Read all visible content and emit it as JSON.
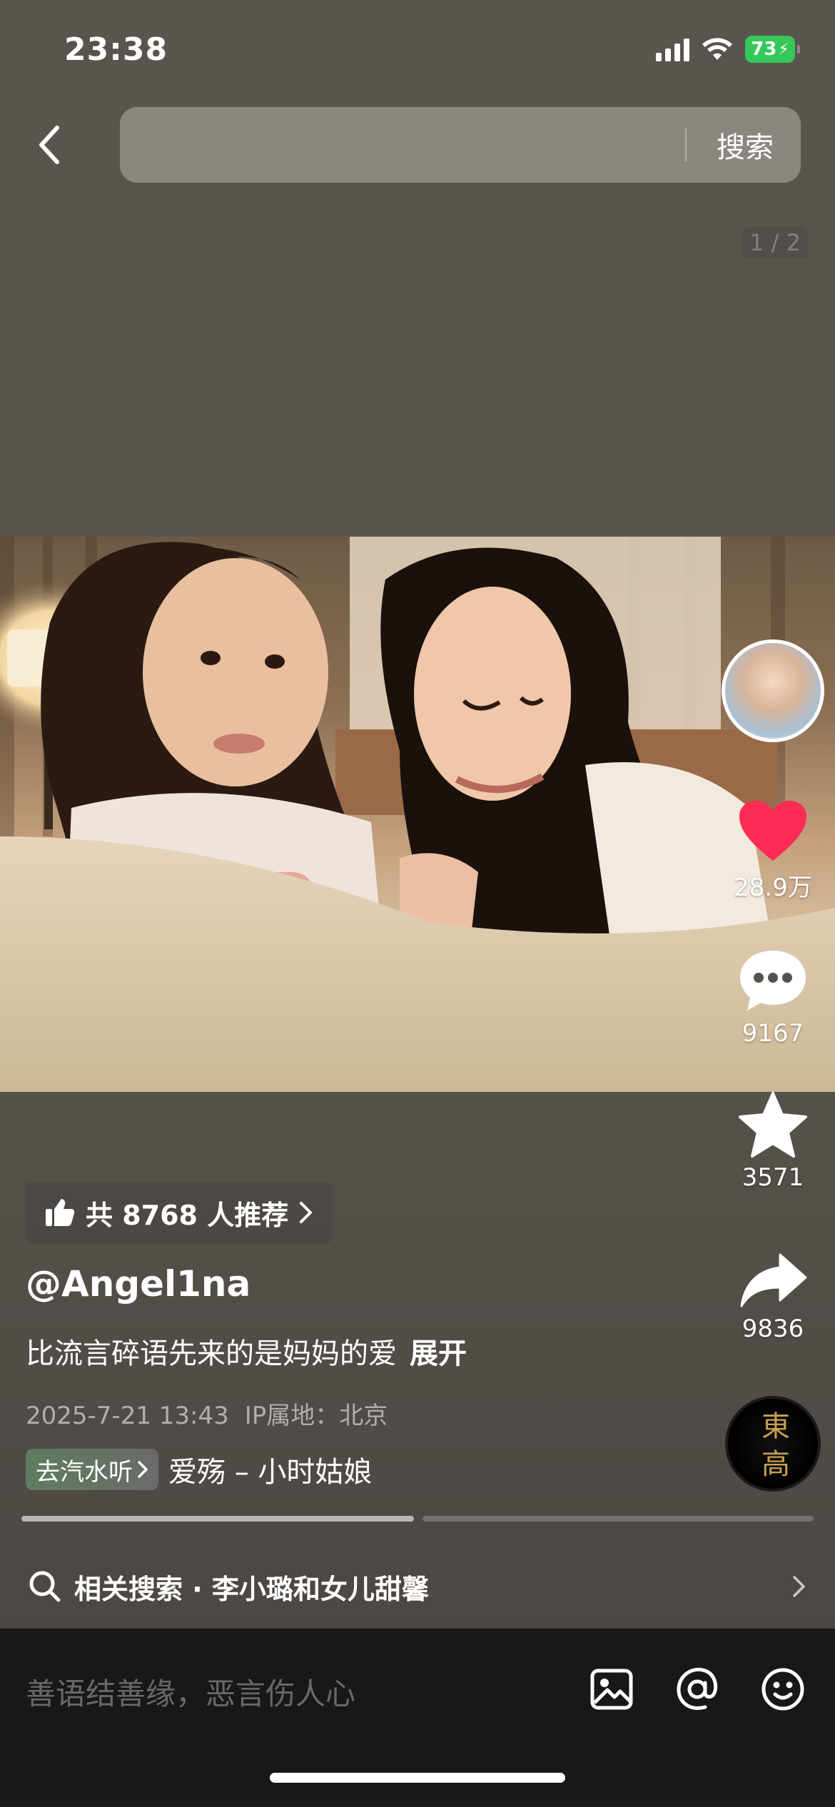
{
  "status_bar": {
    "time": "23:38",
    "battery": "73"
  },
  "search": {
    "button_label": "搜索",
    "placeholder": ""
  },
  "page_indicator": "1 / 2",
  "actions": {
    "likes": "28.9万",
    "comments": "9167",
    "favorites": "3571",
    "shares": "9836"
  },
  "recommend": {
    "text": "共 8768 人推荐"
  },
  "post": {
    "author": "@Angel1na",
    "caption": "比流言碎语先来的是妈妈的爱",
    "expand_label": "展开",
    "date": "2025-7-21 13:43",
    "ip_location": "IP属地：北京"
  },
  "music": {
    "tag_label": "去汽水听",
    "title": "爱殇 – 小时姑娘",
    "disc_text": "東 高"
  },
  "related_search": {
    "text": "相关搜索 · 李小璐和女儿甜馨"
  },
  "comment_bar": {
    "placeholder": "善语结善缘，恶言伤人心"
  },
  "colors": {
    "like_red": "#fe2c55",
    "battery_green": "#34c759",
    "background": "#58524c",
    "comment_bar": "#181818"
  },
  "icons": [
    "back-chevron-icon",
    "thumbs-up-icon",
    "heart-icon",
    "comment-bubble-icon",
    "star-icon",
    "share-arrow-icon",
    "search-icon",
    "image-icon",
    "at-icon",
    "emoji-icon"
  ]
}
